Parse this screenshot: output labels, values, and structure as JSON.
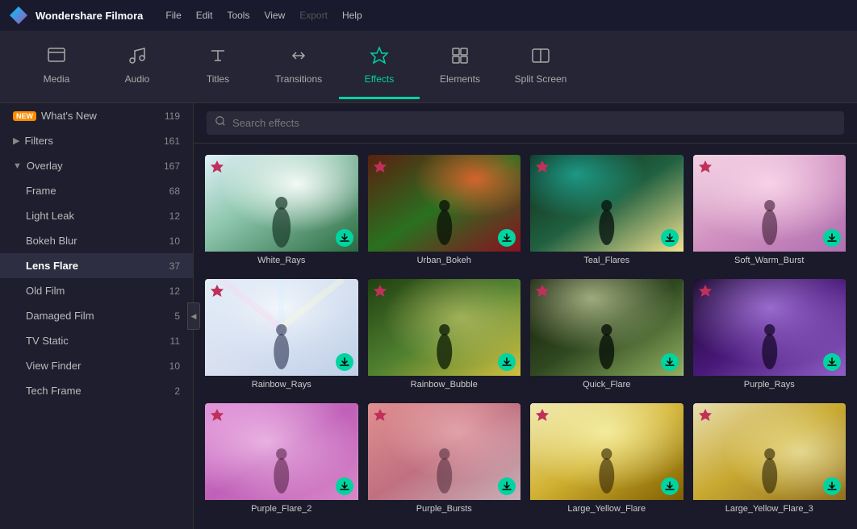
{
  "app": {
    "name": "Wondershare Filmora",
    "logo": "diamond"
  },
  "titlebar": {
    "menu": [
      "File",
      "Edit",
      "Tools",
      "View",
      "Export",
      "Help"
    ],
    "export_disabled": true
  },
  "toolbar": {
    "items": [
      {
        "id": "media",
        "label": "Media",
        "icon": "☐"
      },
      {
        "id": "audio",
        "label": "Audio",
        "icon": "♪"
      },
      {
        "id": "titles",
        "label": "Titles",
        "icon": "T"
      },
      {
        "id": "transitions",
        "label": "Transitions",
        "icon": "⇄"
      },
      {
        "id": "effects",
        "label": "Effects",
        "icon": "✦",
        "active": true
      },
      {
        "id": "elements",
        "label": "Elements",
        "icon": "⊞"
      },
      {
        "id": "split-screen",
        "label": "Split Screen",
        "icon": "⊟"
      }
    ]
  },
  "sidebar": {
    "items": [
      {
        "id": "whats-new",
        "label": "What's New",
        "count": 119,
        "badge": "NEW",
        "level": 0,
        "arrow": ""
      },
      {
        "id": "filters",
        "label": "Filters",
        "count": 161,
        "level": 0,
        "arrow": "▶"
      },
      {
        "id": "overlay",
        "label": "Overlay",
        "count": 167,
        "level": 0,
        "arrow": "▼",
        "expanded": true
      },
      {
        "id": "frame",
        "label": "Frame",
        "count": 68,
        "level": 1
      },
      {
        "id": "light-leak",
        "label": "Light Leak",
        "count": 12,
        "level": 1
      },
      {
        "id": "bokeh-blur",
        "label": "Bokeh Blur",
        "count": 10,
        "level": 1
      },
      {
        "id": "lens-flare",
        "label": "Lens Flare",
        "count": 37,
        "level": 1,
        "active": true
      },
      {
        "id": "old-film",
        "label": "Old Film",
        "count": 12,
        "level": 1
      },
      {
        "id": "damaged-film",
        "label": "Damaged Film",
        "count": 5,
        "level": 1
      },
      {
        "id": "tv-static",
        "label": "TV Static",
        "count": 11,
        "level": 1
      },
      {
        "id": "view-finder",
        "label": "View Finder",
        "count": 10,
        "level": 1
      },
      {
        "id": "tech-frame",
        "label": "Tech Frame",
        "count": 2,
        "level": 1
      }
    ]
  },
  "search": {
    "placeholder": "Search effects"
  },
  "effects": {
    "items": [
      {
        "id": "white-rays",
        "label": "White_Rays",
        "thumb_class": "thumb-white-rays"
      },
      {
        "id": "urban-bokeh",
        "label": "Urban_Bokeh",
        "thumb_class": "thumb-urban-bokeh"
      },
      {
        "id": "teal-flares",
        "label": "Teal_Flares",
        "thumb_class": "thumb-teal-flares"
      },
      {
        "id": "soft-warm-burst",
        "label": "Soft_Warm_Burst",
        "thumb_class": "thumb-soft-warm"
      },
      {
        "id": "rainbow-rays",
        "label": "Rainbow_Rays",
        "thumb_class": "thumb-rainbow-rays"
      },
      {
        "id": "rainbow-bubble",
        "label": "Rainbow_Bubble",
        "thumb_class": "thumb-rainbow-bubble"
      },
      {
        "id": "quick-flare",
        "label": "Quick_Flare",
        "thumb_class": "thumb-quick-flare"
      },
      {
        "id": "purple-rays",
        "label": "Purple_Rays",
        "thumb_class": "thumb-purple-rays"
      },
      {
        "id": "purple-flare-2",
        "label": "Purple_Flare_2",
        "thumb_class": "thumb-purple-flare2"
      },
      {
        "id": "purple-bursts",
        "label": "Purple_Bursts",
        "thumb_class": "thumb-purple-bursts"
      },
      {
        "id": "large-yellow-flare",
        "label": "Large_Yellow_Flare",
        "thumb_class": "thumb-large-yellow"
      },
      {
        "id": "large-yellow-flare-3",
        "label": "Large_Yellow_Flare_3",
        "thumb_class": "thumb-large-yellow3"
      }
    ]
  },
  "colors": {
    "accent": "#00d4a0",
    "active_tab": "#00d4a0",
    "fav": "#c0305a",
    "badge_new": "#ff8c00"
  }
}
